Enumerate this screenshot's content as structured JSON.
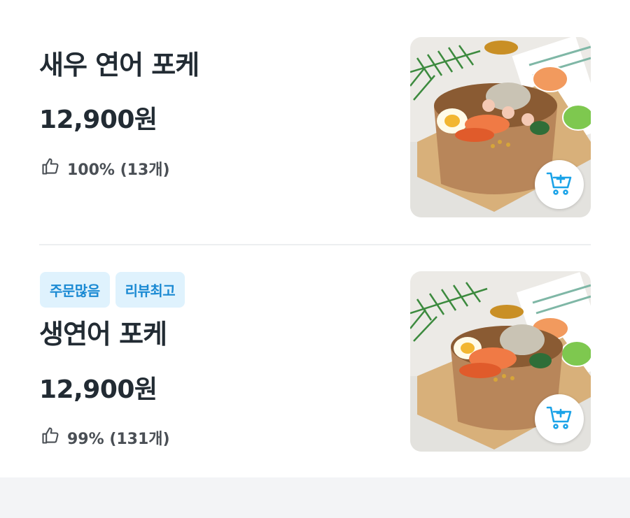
{
  "items": [
    {
      "name": "새우 연어 포케",
      "price": "12,900원",
      "rating": "100% (13개)",
      "badges": []
    },
    {
      "name": "생연어 포케",
      "price": "12,900원",
      "rating": "99% (131개)",
      "badges": [
        "주문많음",
        "리뷰최고"
      ]
    }
  ],
  "colors": {
    "badge_bg": "#dff2fd",
    "badge_text": "#1b8ad3",
    "cart_icon": "#1ba3e8",
    "text": "#222b33"
  },
  "icons": {
    "rating": "thumbs-up-icon",
    "cart": "add-to-cart-icon"
  }
}
